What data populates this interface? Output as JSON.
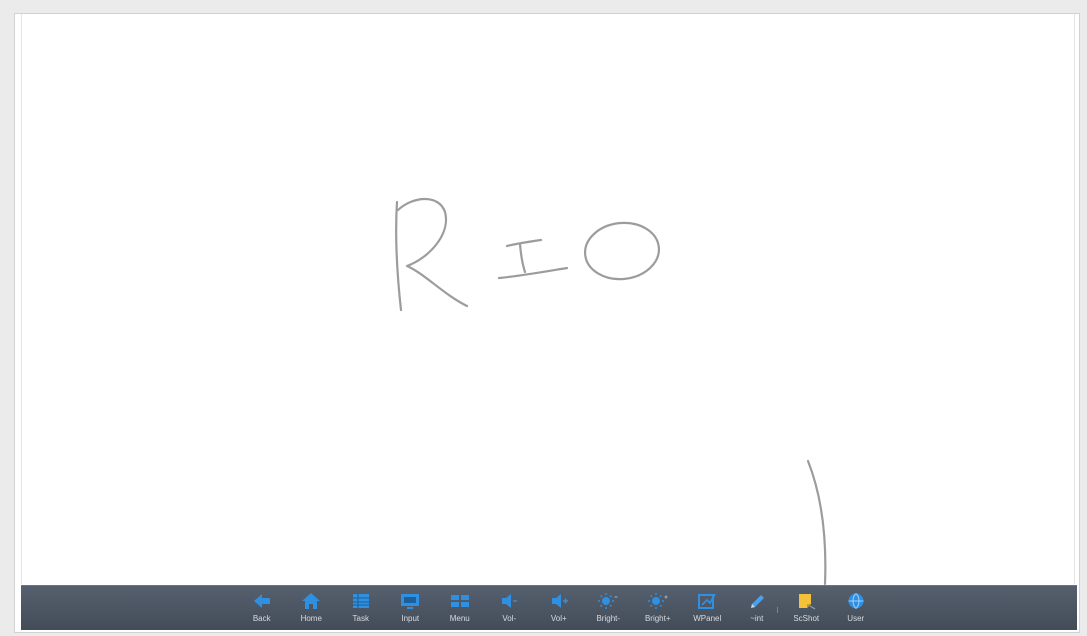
{
  "whiteboard": {
    "handwriting_text": "RIO"
  },
  "toolbar": {
    "accent_color": "#2f8fe0",
    "items": [
      {
        "label": "Back",
        "icon": "back-arrow-icon"
      },
      {
        "label": "Home",
        "icon": "home-icon"
      },
      {
        "label": "Task",
        "icon": "task-icon"
      },
      {
        "label": "Input",
        "icon": "input-icon"
      },
      {
        "label": "Menu",
        "icon": "menu-icon"
      },
      {
        "label": "Vol-",
        "icon": "volume-down-icon"
      },
      {
        "label": "Vol+",
        "icon": "volume-up-icon"
      },
      {
        "label": "Bright-",
        "icon": "brightness-down-icon"
      },
      {
        "label": "Bright+",
        "icon": "brightness-up-icon"
      },
      {
        "label": "WPanel",
        "icon": "whiteboard-panel-icon"
      },
      {
        "label": "~int",
        "icon": "pen-icon"
      },
      {
        "label": "ScShot",
        "icon": "screenshot-icon"
      },
      {
        "label": "User",
        "icon": "user-globe-icon"
      }
    ]
  }
}
